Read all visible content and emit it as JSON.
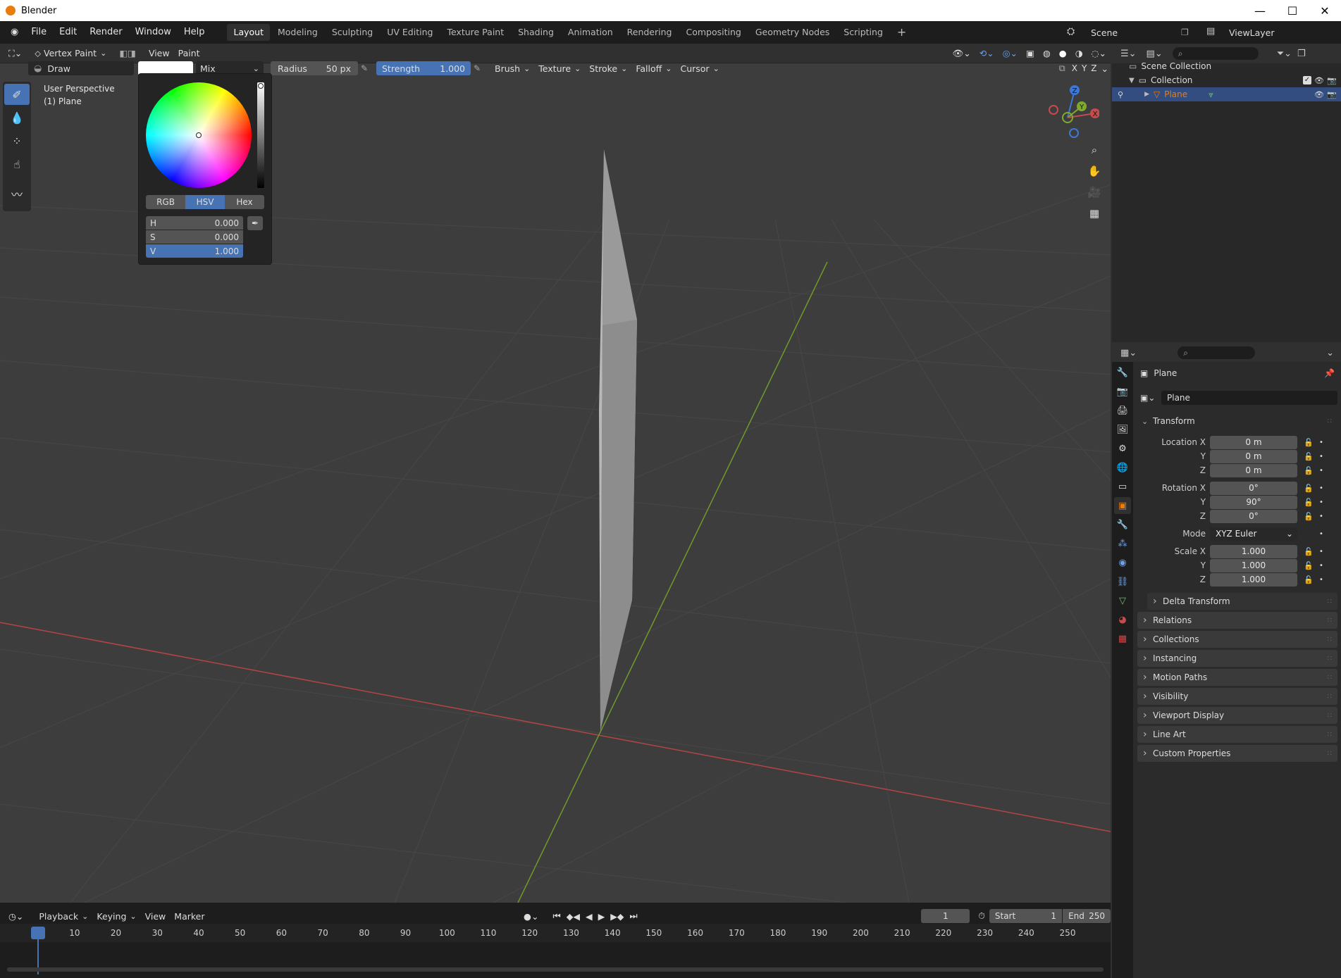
{
  "window": {
    "title": "Blender"
  },
  "menu": {
    "items": [
      "File",
      "Edit",
      "Render",
      "Window",
      "Help"
    ]
  },
  "workspaces": {
    "tabs": [
      "Layout",
      "Modeling",
      "Sculpting",
      "UV Editing",
      "Texture Paint",
      "Shading",
      "Animation",
      "Rendering",
      "Compositing",
      "Geometry Nodes",
      "Scripting"
    ],
    "add": "+"
  },
  "scene": {
    "label": "Scene",
    "viewlayer": "ViewLayer"
  },
  "viewport_header": {
    "mode": "Vertex Paint",
    "view": "View",
    "paint": "Paint"
  },
  "tool_header": {
    "brush": "Draw",
    "blend": "Mix",
    "radius_label": "Radius",
    "radius_value": "50 px",
    "strength_label": "Strength",
    "strength_value": "1.000",
    "strength_fraction": 1.0,
    "menus": [
      "Brush",
      "Texture",
      "Stroke",
      "Falloff",
      "Cursor"
    ],
    "axes": [
      "X",
      "Y",
      "Z"
    ]
  },
  "overlay_text": {
    "line1": "User Perspective",
    "line2": "(1) Plane"
  },
  "color_picker": {
    "modes": [
      "RGB",
      "HSV",
      "Hex"
    ],
    "active_mode": "HSV",
    "h_label": "H",
    "h_value": "0.000",
    "s_label": "S",
    "s_value": "0.000",
    "v_label": "V",
    "v_value": "1.000",
    "swatch_color": "#ffffff"
  },
  "gizmo": {
    "z": "Z",
    "y": "Y",
    "x": "X"
  },
  "outliner": {
    "scene_collection": "Scene Collection",
    "collection": "Collection",
    "object": "Plane"
  },
  "properties": {
    "object_name": "Plane",
    "datablock_name": "Plane",
    "transform": "Transform",
    "location_x_label": "Location X",
    "location_x": "0 m",
    "location_y_label": "Y",
    "location_y": "0 m",
    "location_z_label": "Z",
    "location_z": "0 m",
    "rotation_x_label": "Rotation X",
    "rotation_x": "0°",
    "rotation_y_label": "Y",
    "rotation_y": "90°",
    "rotation_z_label": "Z",
    "rotation_z": "0°",
    "mode_label": "Mode",
    "mode_value": "XYZ Euler",
    "scale_x_label": "Scale X",
    "scale_x": "1.000",
    "scale_y_label": "Y",
    "scale_y": "1.000",
    "scale_z_label": "Z",
    "scale_z": "1.000",
    "delta_transform": "Delta Transform",
    "panels": [
      "Relations",
      "Collections",
      "Instancing",
      "Motion Paths",
      "Visibility",
      "Viewport Display",
      "Line Art",
      "Custom Properties"
    ]
  },
  "timeline": {
    "playback": "Playback",
    "keying": "Keying",
    "view": "View",
    "marker": "Marker",
    "current_frame": "1",
    "start_label": "Start",
    "start_value": "1",
    "end_label": "End",
    "end_value": "250",
    "ruler": [
      "1",
      "10",
      "20",
      "30",
      "40",
      "50",
      "60",
      "70",
      "80",
      "90",
      "100",
      "110",
      "120",
      "130",
      "140",
      "150",
      "160",
      "170",
      "180",
      "190",
      "200",
      "210",
      "220",
      "230",
      "240",
      "250"
    ]
  },
  "colors": {
    "accent": "#4772b3",
    "x_axis": "#c94a4a",
    "y_axis": "#7eab2e",
    "z_axis": "#3d78d8",
    "object_orange": "#e87d0d"
  }
}
